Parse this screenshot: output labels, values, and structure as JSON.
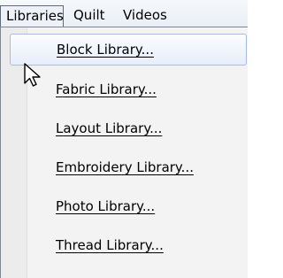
{
  "menubar": {
    "items": [
      {
        "label": "Libraries"
      },
      {
        "label": "Quilt"
      },
      {
        "label": "Videos"
      }
    ]
  },
  "menu": {
    "items": [
      {
        "label": "Block Library...",
        "accel": "B",
        "rest": "lock Library..."
      },
      {
        "label": "Fabric Library...",
        "accel": "F",
        "rest": "abric Library..."
      },
      {
        "label": "Layout Library...",
        "accel": "L",
        "rest": "ayout Library..."
      },
      {
        "label": "Embroidery Library...",
        "accel": "E",
        "rest": "mbroidery Library..."
      },
      {
        "label": "Photo Library...",
        "accel": "P",
        "rest": "hoto Library..."
      },
      {
        "label": "Thread Library...",
        "accel": "T",
        "rest": "hread Library..."
      }
    ]
  },
  "colors": {
    "highlight_border": "#a8bcdc",
    "menu_background": "#f3f3f3"
  },
  "icons": {
    "cursor": "mouse-pointer-icon"
  }
}
